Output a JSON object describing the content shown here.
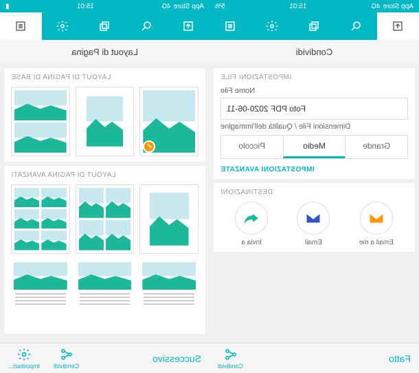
{
  "status": {
    "carrier": "4G",
    "app_left": "App Store",
    "time": "15:01",
    "sig_right": "5%"
  },
  "left_screen": {
    "page_title": "Condividi",
    "sections": {
      "file_settings": "IMPOSTAZIONI FILE",
      "file_name_label": "Nome File",
      "file_name_value": "Foto PDF 2020-06-11",
      "quality_label": "Dimensioni File / Qualità dell'immagine",
      "seg": {
        "large": "Grande",
        "medium": "Medio",
        "small": "Piccolo"
      },
      "advanced": "IMPOSTAZIONI AVANZATE",
      "destinations": "DESTINAZIONI",
      "dest": {
        "email_me": "Email a me",
        "email": "Email",
        "send_to": "Invia a"
      }
    },
    "bottom": {
      "primary": "Fatto",
      "share": "Condividi"
    }
  },
  "right_screen": {
    "page_title": "Layout di Pagina",
    "sections": {
      "basic": "LAYOUT DI PAGINA DI BASE",
      "advanced": "LAYOUT DI PAGINA AVANZATI"
    },
    "bottom": {
      "primary": "Successivo",
      "share": "Condividi",
      "settings": "Impostazi..."
    }
  }
}
